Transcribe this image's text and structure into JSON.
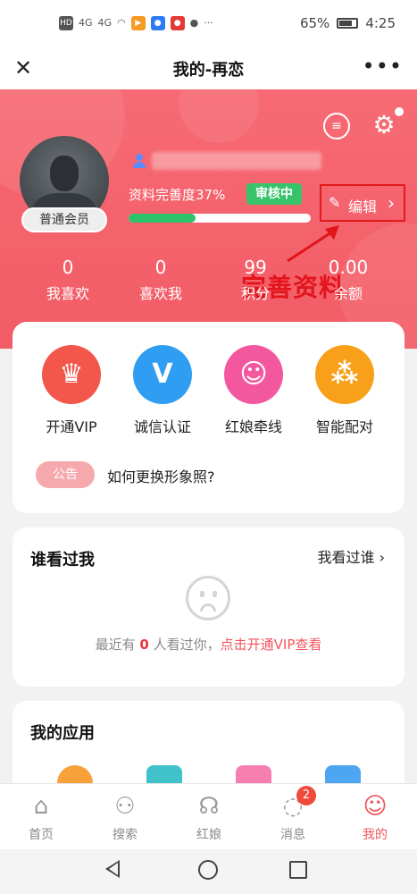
{
  "status_bar": {
    "hd_label": "HD",
    "signal_1": "4G",
    "signal_2": "4G",
    "more": "···",
    "battery_percent": "65%",
    "time": "4:25"
  },
  "nav": {
    "title": "我的-再恋",
    "close_icon": "close-icon",
    "more_icon": "more-icon"
  },
  "profile": {
    "member_level": "普通会员",
    "completeness_text": "资料完善度37%",
    "completeness_value": 37,
    "review_status": "审核中",
    "edit_label": "编辑",
    "annotation": "完善资料",
    "accent_color": "#f25c66",
    "progress_color": "#2ec26a"
  },
  "stats": [
    {
      "value": "0",
      "label": "我喜欢"
    },
    {
      "value": "0",
      "label": "喜欢我"
    },
    {
      "value": "99",
      "label": "积分"
    },
    {
      "value": "0.00",
      "label": "余额"
    }
  ],
  "features": [
    {
      "label": "开通VIP",
      "icon": "crown-icon",
      "color": "#f3574c"
    },
    {
      "label": "诚信认证",
      "icon": "shield-icon",
      "color": "#2f9df1"
    },
    {
      "label": "红娘牵线",
      "icon": "matchmaker-icon",
      "color": "#f3589e"
    },
    {
      "label": "智能配对",
      "icon": "network-icon",
      "color": "#f9a01a"
    }
  ],
  "notice": {
    "badge": "公告",
    "text": "如何更换形象照?"
  },
  "visitors": {
    "title": "谁看过我",
    "link": "我看过谁",
    "text_before": "最近有",
    "count": "0",
    "text_after": "人看过你，",
    "cta": "点击开通VIP查看"
  },
  "apps": {
    "title": "我的应用"
  },
  "tabs": [
    {
      "label": "首页",
      "icon": "home-icon"
    },
    {
      "label": "搜索",
      "icon": "people-icon"
    },
    {
      "label": "红娘",
      "icon": "headset-icon"
    },
    {
      "label": "消息",
      "icon": "chat-icon",
      "badge": "2"
    },
    {
      "label": "我的",
      "icon": "profile-icon",
      "active": true
    }
  ]
}
